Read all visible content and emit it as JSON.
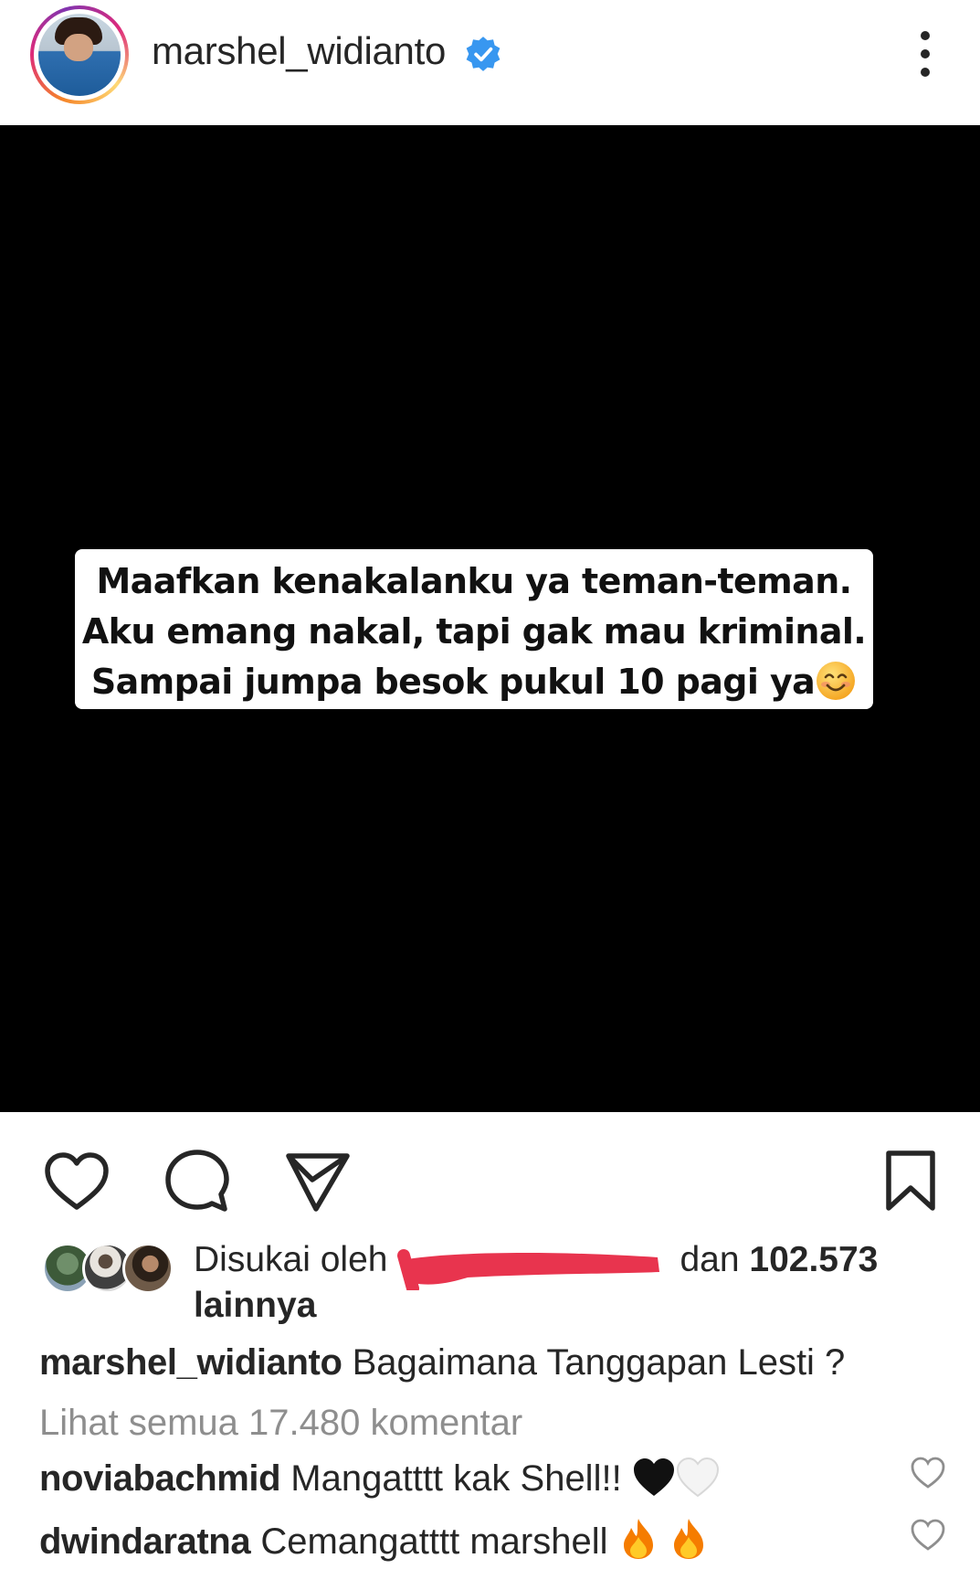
{
  "header": {
    "username": "marshel_widianto",
    "verified": true,
    "avatar_icon": "profile-photo",
    "more_icon": "more-vertical-icon"
  },
  "post": {
    "background_color": "#000000",
    "image_text": {
      "line1": "Maafkan kenakalanku ya teman-teman.",
      "line2": "Aku emang nakal, tapi gak mau kriminal.",
      "line3": "Sampai jumpa besok pukul 10 pagi ya",
      "emoji": "smiling-face-emoji"
    }
  },
  "actions": {
    "like_icon": "heart-icon",
    "comment_icon": "comment-icon",
    "share_icon": "send-icon",
    "save_icon": "bookmark-icon"
  },
  "likes": {
    "prefix": "Disukai oleh",
    "conjunction": "dan",
    "count": "102.573",
    "suffix": "lainnya"
  },
  "caption": {
    "username": "marshel_widianto",
    "text": "Bagaimana Tanggapan Lesti ?"
  },
  "view_comments": "Lihat semua 17.480 komentar",
  "comments": [
    {
      "username": "noviabachmid",
      "text": "Mangatttt kak Shell!!",
      "emojis": [
        "black-heart",
        "white-heart"
      ]
    },
    {
      "username": "dwindaratna",
      "text": "Cemangatttt marshell",
      "emojis": [
        "fire",
        "fire"
      ]
    }
  ],
  "colors": {
    "verified_blue": "#3897f0",
    "redaction_red": "#e8344e",
    "muted_text": "#8e8e8e"
  }
}
